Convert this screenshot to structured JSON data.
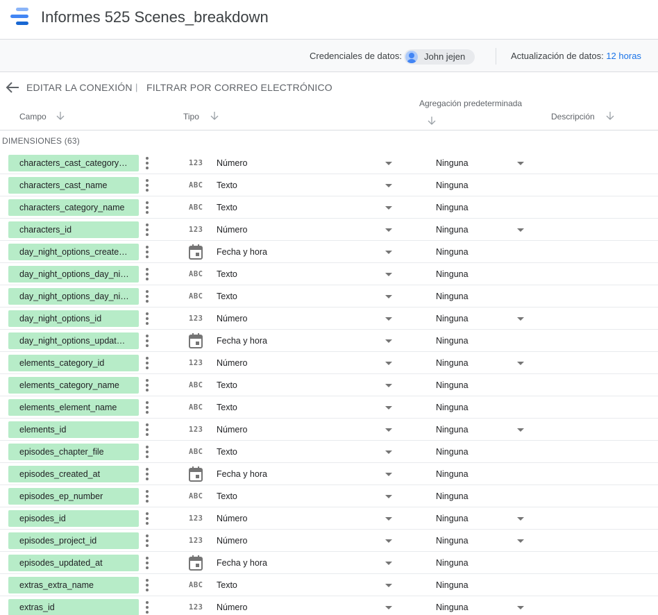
{
  "header": {
    "title": "Informes 525 Scenes_breakdown"
  },
  "credentials": {
    "label": "Credenciales de datos:",
    "user": "John jejen",
    "update_label": "Actualización de datos:",
    "update_value": "12 horas"
  },
  "actions": {
    "edit_connection": "EDITAR LA CONEXIÓN",
    "separator": "|",
    "filter_email": "FILTRAR POR CORREO ELECTRÓNICO"
  },
  "columns": {
    "field": "Campo",
    "type": "Tipo",
    "aggregation": "Agregación predeterminada",
    "description": "Descripción"
  },
  "section": {
    "label": "DIMENSIONES (63)"
  },
  "type_icons": {
    "number": "123",
    "text": "ABC",
    "date": "calendar-icon"
  },
  "colors": {
    "chip": "#b7ecc8",
    "accent": "#1a73e8"
  },
  "rows": [
    {
      "field": "characters_cast_category…",
      "icon": "123",
      "type": "Número",
      "agg": "Ninguna",
      "agg_dropdown": true
    },
    {
      "field": "characters_cast_name",
      "icon": "ABC",
      "type": "Texto",
      "agg": "Ninguna",
      "agg_dropdown": false
    },
    {
      "field": "characters_category_name",
      "icon": "ABC",
      "type": "Texto",
      "agg": "Ninguna",
      "agg_dropdown": false
    },
    {
      "field": "characters_id",
      "icon": "123",
      "type": "Número",
      "agg": "Ninguna",
      "agg_dropdown": true
    },
    {
      "field": "day_night_options_create…",
      "icon": "CAL",
      "type": "Fecha y hora",
      "agg": "Ninguna",
      "agg_dropdown": false
    },
    {
      "field": "day_night_options_day_ni…",
      "icon": "ABC",
      "type": "Texto",
      "agg": "Ninguna",
      "agg_dropdown": false
    },
    {
      "field": "day_night_options_day_ni…",
      "icon": "ABC",
      "type": "Texto",
      "agg": "Ninguna",
      "agg_dropdown": false
    },
    {
      "field": "day_night_options_id",
      "icon": "123",
      "type": "Número",
      "agg": "Ninguna",
      "agg_dropdown": true
    },
    {
      "field": "day_night_options_updat…",
      "icon": "CAL",
      "type": "Fecha y hora",
      "agg": "Ninguna",
      "agg_dropdown": false
    },
    {
      "field": "elements_category_id",
      "icon": "123",
      "type": "Número",
      "agg": "Ninguna",
      "agg_dropdown": true
    },
    {
      "field": "elements_category_name",
      "icon": "ABC",
      "type": "Texto",
      "agg": "Ninguna",
      "agg_dropdown": false
    },
    {
      "field": "elements_element_name",
      "icon": "ABC",
      "type": "Texto",
      "agg": "Ninguna",
      "agg_dropdown": false
    },
    {
      "field": "elements_id",
      "icon": "123",
      "type": "Número",
      "agg": "Ninguna",
      "agg_dropdown": true
    },
    {
      "field": "episodes_chapter_file",
      "icon": "ABC",
      "type": "Texto",
      "agg": "Ninguna",
      "agg_dropdown": false
    },
    {
      "field": "episodes_created_at",
      "icon": "CAL",
      "type": "Fecha y hora",
      "agg": "Ninguna",
      "agg_dropdown": false
    },
    {
      "field": "episodes_ep_number",
      "icon": "ABC",
      "type": "Texto",
      "agg": "Ninguna",
      "agg_dropdown": false
    },
    {
      "field": "episodes_id",
      "icon": "123",
      "type": "Número",
      "agg": "Ninguna",
      "agg_dropdown": true
    },
    {
      "field": "episodes_project_id",
      "icon": "123",
      "type": "Número",
      "agg": "Ninguna",
      "agg_dropdown": true
    },
    {
      "field": "episodes_updated_at",
      "icon": "CAL",
      "type": "Fecha y hora",
      "agg": "Ninguna",
      "agg_dropdown": false
    },
    {
      "field": "extras_extra_name",
      "icon": "ABC",
      "type": "Texto",
      "agg": "Ninguna",
      "agg_dropdown": false
    },
    {
      "field": "extras_id",
      "icon": "123",
      "type": "Número",
      "agg": "Ninguna",
      "agg_dropdown": true
    }
  ]
}
